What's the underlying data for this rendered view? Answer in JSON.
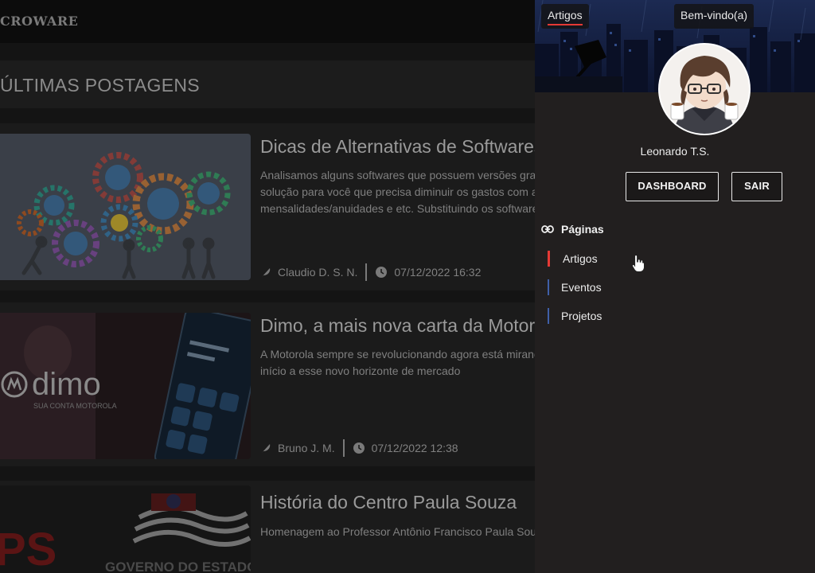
{
  "header": {
    "logo": "CROWARE"
  },
  "section": {
    "title": "ÚLTIMAS POSTAGENS"
  },
  "posts": [
    {
      "title": "Dicas de Alternativas de Softwares Gratuitos",
      "excerpt_lines": [
        "Analisamos alguns softwares que possuem versões gratuitas ou que podem ser uma alternativa mais barata, uma",
        "solução para você que precisa diminuir os gastos com a compra de licenças e",
        "mensalidades/anuidades e etc. Substituindo os softwares pagos que são já usados pelo seu dia-a-dia. Vem"
      ],
      "author": "Claudio D. S. N.",
      "date": "07/12/2022 16:32"
    },
    {
      "title": "Dimo, a mais nova carta da Motorola",
      "excerpt_lines": [
        "A Motorola sempre se revolucionando agora está mirando o mercado financeiro e escolheu o Brasil para dar",
        "início a esse novo horizonte de mercado"
      ],
      "author": "Bruno J. M.",
      "date": "07/12/2022 12:38",
      "thumb_brand": "dimo",
      "thumb_sub": "SUA CONTA MOTOROLA"
    },
    {
      "title": "História do Centro Paula Souza",
      "excerpt_lines": [
        "Homenagem ao Professor Antônio Francisco Paula Souza"
      ],
      "thumb_text": "GOVERNO DO ESTADO",
      "thumb_letters": "PS"
    }
  ],
  "panel": {
    "tab_active": "Artigos",
    "tab_welcome": "Bem-vindo(a)",
    "user_name": "Leonardo T.S.",
    "dashboard_label": "DASHBOARD",
    "logout_label": "SAIR",
    "nav_heading": "Páginas",
    "nav_items": [
      {
        "label": "Artigos",
        "active": true
      },
      {
        "label": "Eventos",
        "active": false
      },
      {
        "label": "Projetos",
        "active": false
      }
    ]
  },
  "colors": {
    "accent": "#e53935",
    "nav_inactive": "#3f5fa8",
    "panel_bg": "#221f1f"
  }
}
